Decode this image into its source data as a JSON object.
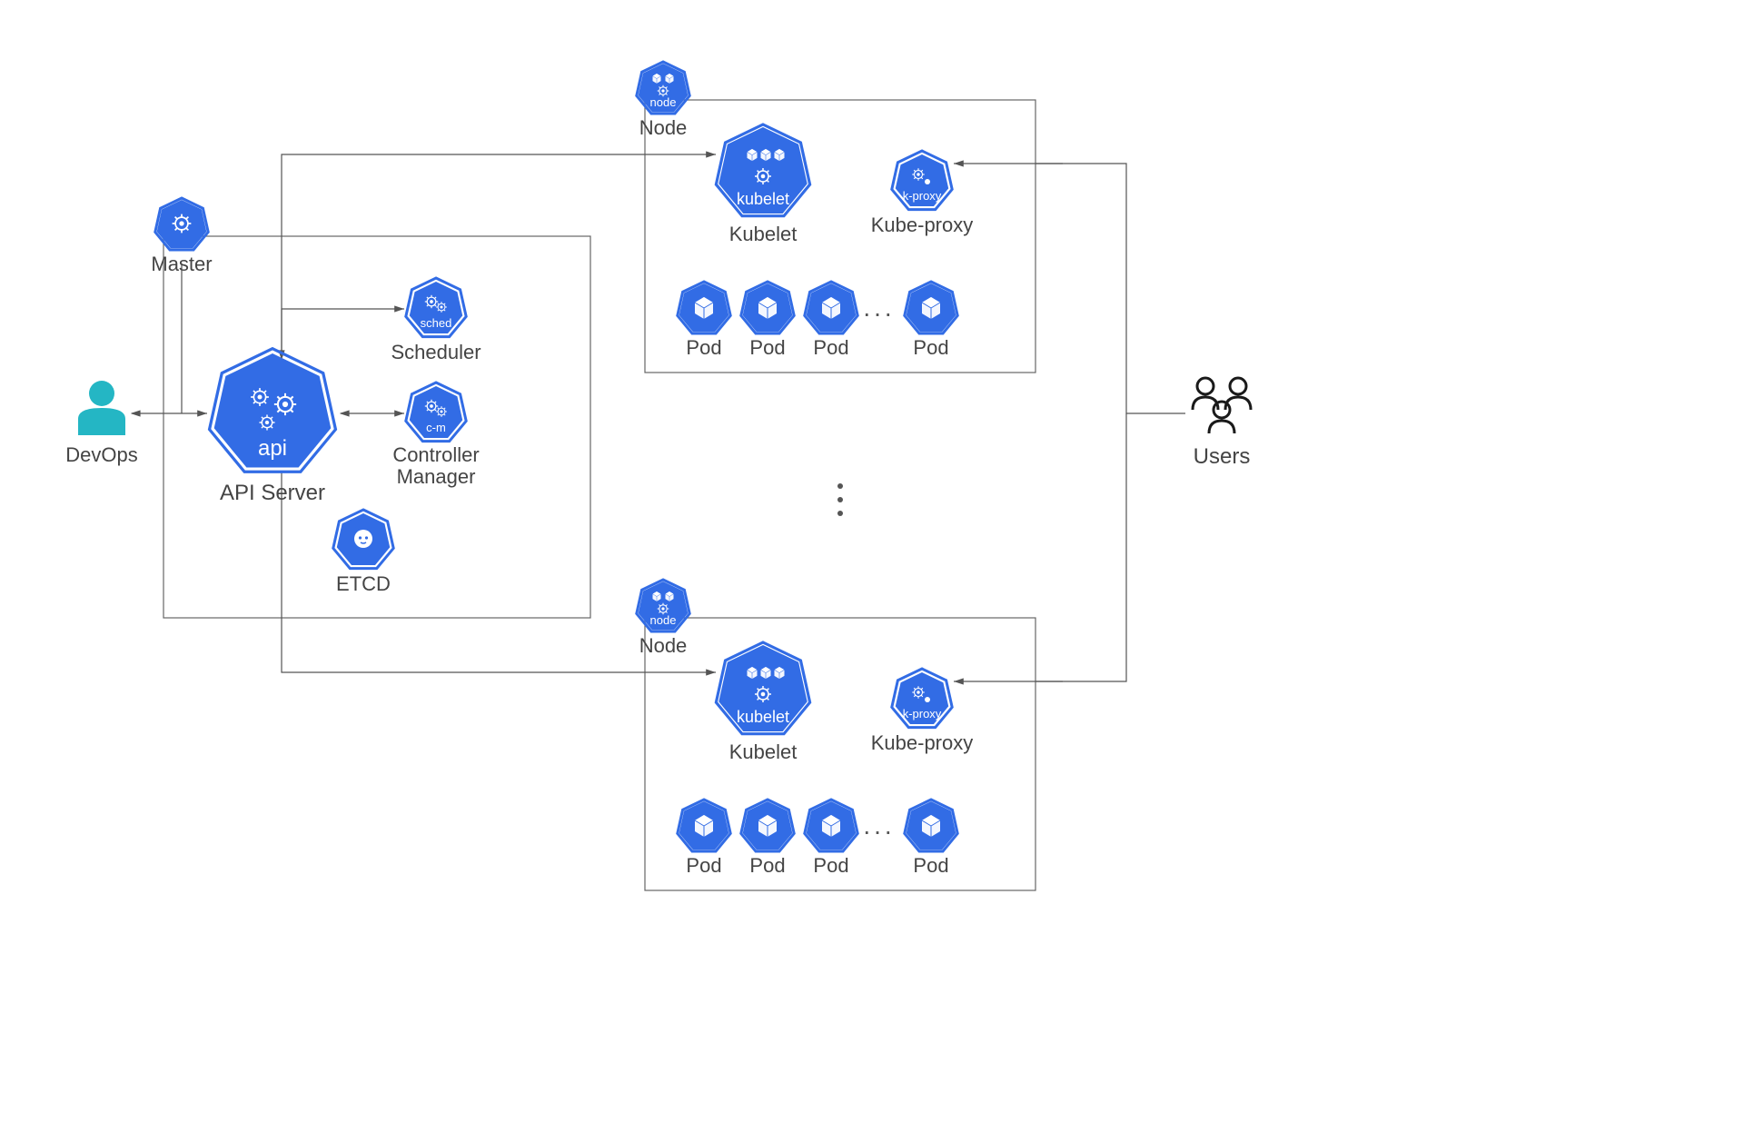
{
  "devops": {
    "label": "DevOps"
  },
  "users": {
    "label": "Users"
  },
  "master": {
    "label": "Master",
    "api": {
      "caption": "API Server",
      "badge": "api"
    },
    "scheduler": {
      "caption": "Scheduler",
      "badge": "sched"
    },
    "controller": {
      "caption": "Controller",
      "caption2": "Manager",
      "badge": "c-m"
    },
    "etcd": {
      "caption": "ETCD"
    }
  },
  "nodes": [
    {
      "label": "Node",
      "badge": "node",
      "kubelet": {
        "caption": "Kubelet",
        "badge": "kubelet"
      },
      "kubeproxy": {
        "caption": "Kube-proxy",
        "badge": "k-proxy"
      },
      "pods": [
        {
          "label": "Pod"
        },
        {
          "label": "Pod"
        },
        {
          "label": "Pod"
        },
        {
          "label": "Pod"
        }
      ],
      "ellipsis": "..."
    },
    {
      "label": "Node",
      "badge": "node",
      "kubelet": {
        "caption": "Kubelet",
        "badge": "kubelet"
      },
      "kubeproxy": {
        "caption": "Kube-proxy",
        "badge": "k-proxy"
      },
      "pods": [
        {
          "label": "Pod"
        },
        {
          "label": "Pod"
        },
        {
          "label": "Pod"
        },
        {
          "label": "Pod"
        }
      ],
      "ellipsis": "..."
    }
  ],
  "nodes_vellipsis": "⋮",
  "colors": {
    "k8s": "#326ce5",
    "text": "#444",
    "line": "#555",
    "frame": "#666",
    "devops": "#24b6c4"
  }
}
